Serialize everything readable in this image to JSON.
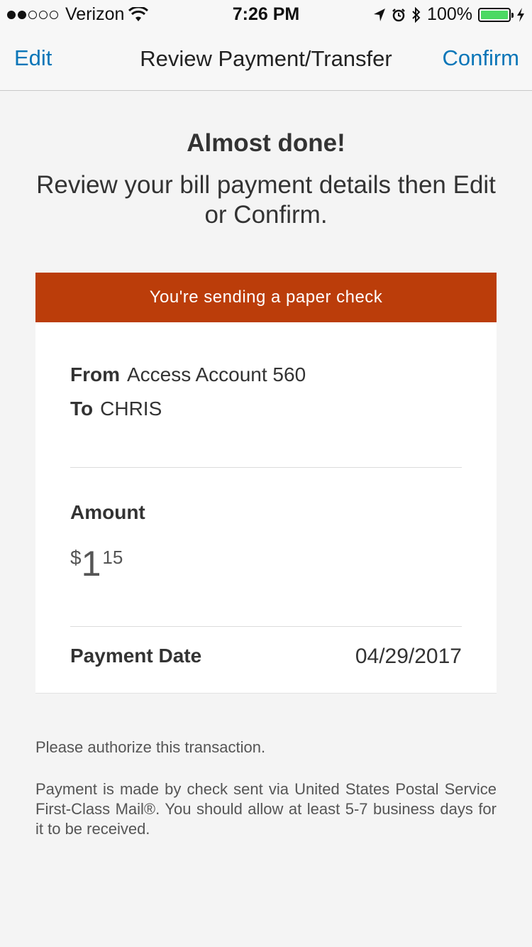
{
  "status_bar": {
    "carrier": "Verizon",
    "time": "7:26 PM",
    "battery": "100%",
    "battery_level": 1.0,
    "signal_bars_filled": 2,
    "signal_bars_total": 5,
    "icons": [
      "signal-dots-icon",
      "wifi-icon",
      "location-arrow-icon",
      "alarm-icon",
      "bluetooth-icon",
      "battery-icon",
      "charging-bolt-icon"
    ]
  },
  "nav": {
    "edit_label": "Edit",
    "title": "Review Payment/Transfer",
    "confirm_label": "Confirm"
  },
  "intro": {
    "heading": "Almost done!",
    "subheading": "Review your bill payment details then Edit or Confirm."
  },
  "banner": {
    "text": "You're sending a paper check",
    "color": "#bb3d0a"
  },
  "details": {
    "from_label": "From",
    "from_value": "Access Account 560",
    "to_label": "To",
    "to_value": "CHRIS",
    "amount_label": "Amount",
    "amount_symbol": "$",
    "amount_dollars": "1",
    "amount_cents": "15",
    "payment_date_label": "Payment Date",
    "payment_date_value": "04/29/2017"
  },
  "notes": {
    "authorize": "Please authorize this transaction.",
    "mail_info": "Payment is made by check sent via United States Postal Service First-Class Mail®. You should allow at least 5-7 business days for it to be received."
  },
  "colors": {
    "link": "#0a76b8",
    "battery_fill": "#4cd964"
  }
}
